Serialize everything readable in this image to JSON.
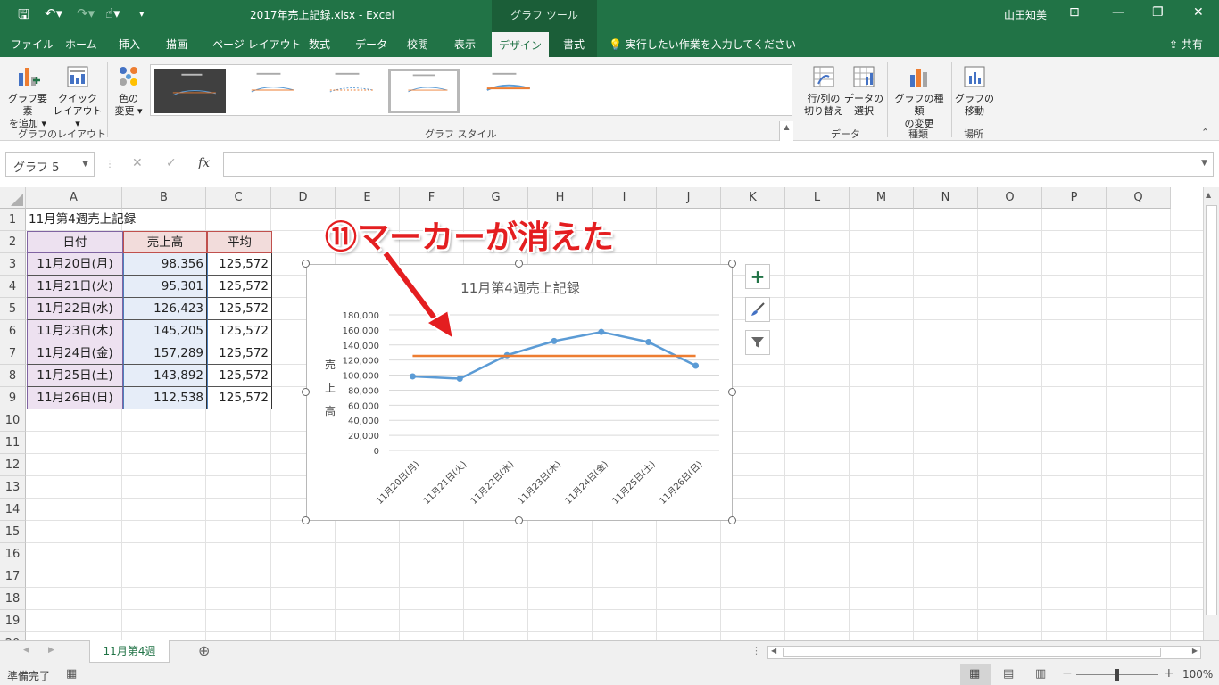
{
  "titlebar": {
    "document_title": "2017年売上記録.xlsx  -  Excel",
    "context_tools": "グラフ ツール",
    "user": "山田知美"
  },
  "tabs": [
    "ファイル",
    "ホーム",
    "挿入",
    "描画",
    "ページ レイアウト",
    "数式",
    "データ",
    "校閲",
    "表示"
  ],
  "active_tab": "デザイン",
  "tab_format": "書式",
  "tellme": "実行したい作業を入力してください",
  "share": "共有",
  "ribbon": {
    "add_element": [
      "グラフ要素",
      "を追加 ▾"
    ],
    "quick_layout": [
      "クイック",
      "レイアウト ▾"
    ],
    "change_color": [
      "色の",
      "変更 ▾"
    ],
    "switch_row_col": [
      "行/列の",
      "切り替え"
    ],
    "select_data": [
      "データの",
      "選択"
    ],
    "change_type": [
      "グラフの種類",
      "の変更"
    ],
    "move_chart": [
      "グラフの",
      "移動"
    ],
    "groups": {
      "layout": "グラフのレイアウト",
      "style": "グラフ スタイル",
      "data": "データ",
      "type": "種類",
      "location": "場所"
    }
  },
  "namebox": "グラフ 5",
  "columns": [
    "A",
    "B",
    "C",
    "D",
    "E",
    "F",
    "G",
    "H",
    "I",
    "J",
    "K",
    "L",
    "M",
    "N",
    "O",
    "P",
    "Q"
  ],
  "rows": [
    "1",
    "2",
    "3",
    "4",
    "5",
    "6",
    "7",
    "8",
    "9",
    "10",
    "11",
    "12",
    "13",
    "14",
    "15",
    "16",
    "17",
    "18",
    "19",
    "20"
  ],
  "sheet": {
    "a1": "11月第4週売上記録",
    "headers": [
      "日付",
      "売上高",
      "平均"
    ],
    "data": [
      [
        "11月20日(月)",
        "98,356",
        "125,572"
      ],
      [
        "11月21日(火)",
        "95,301",
        "125,572"
      ],
      [
        "11月22日(水)",
        "126,423",
        "125,572"
      ],
      [
        "11月23日(木)",
        "145,205",
        "125,572"
      ],
      [
        "11月24日(金)",
        "157,289",
        "125,572"
      ],
      [
        "11月25日(土)",
        "143,892",
        "125,572"
      ],
      [
        "11月26日(日)",
        "112,538",
        "125,572"
      ]
    ]
  },
  "chart_data": {
    "type": "line",
    "title": "11月第4週売上記録",
    "ylabel": "売上高",
    "categories": [
      "11月20日(月)",
      "11月21日(火)",
      "11月22日(水)",
      "11月23日(木)",
      "11月24日(金)",
      "11月25日(土)",
      "11月26日(日)"
    ],
    "series": [
      {
        "values": [
          98356,
          95301,
          126423,
          145205,
          157289,
          143892,
          112538
        ],
        "color": "#5b9bd5",
        "markers": true
      },
      {
        "values": [
          125572,
          125572,
          125572,
          125572,
          125572,
          125572,
          125572
        ],
        "color": "#ed7d31",
        "markers": false
      }
    ],
    "yticks": [
      "0",
      "20,000",
      "40,000",
      "60,000",
      "80,000",
      "100,000",
      "120,000",
      "140,000",
      "160,000",
      "180,000"
    ],
    "ylim": [
      0,
      180000
    ],
    "grid": true
  },
  "annotation": "⑪マーカーが消えた",
  "sheet_tab": "11月第4週",
  "status": {
    "ready": "準備完了",
    "zoom": "100%"
  },
  "colors": {
    "excel_green": "#217346",
    "header_fill": "#f2dcdb",
    "date_fill": "#ede1f0",
    "sales_fill": "#e6edf8",
    "annotation": "#e41e20"
  }
}
